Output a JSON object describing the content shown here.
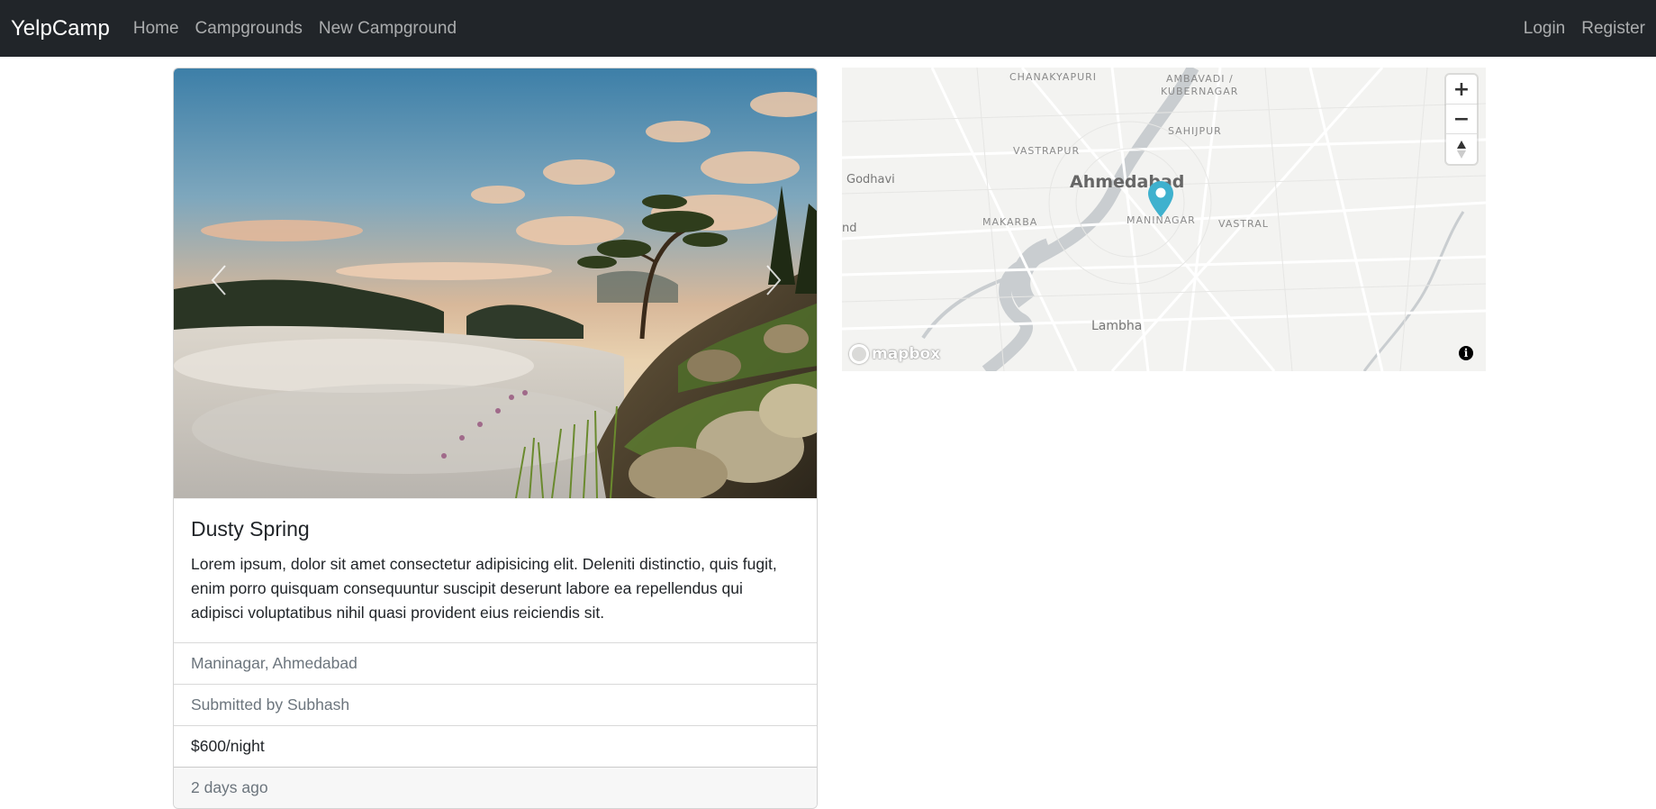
{
  "nav": {
    "brand": "YelpCamp",
    "links": [
      "Home",
      "Campgrounds",
      "New Campground"
    ],
    "right_links": [
      "Login",
      "Register"
    ]
  },
  "campground": {
    "title": "Dusty Spring",
    "description": "Lorem ipsum, dolor sit amet consectetur adipisicing elit. Deleniti distinctio, quis fugit, enim porro quisquam consequuntur suscipit deserunt labore ea repellendus qui adipisci voluptatibus nihil quasi provident eius reiciendis sit.",
    "location": "Maninagar, Ahmedabad",
    "submitted_by": "Submitted by Subhash",
    "price": "$600/night",
    "time_ago": "2 days ago"
  },
  "carousel": {
    "prev_icon": "chevron-left-icon",
    "next_icon": "chevron-right-icon"
  },
  "map": {
    "labels": {
      "chanakyapuri": "CHANAKYAPURI",
      "ambavadi": "AMBAVADI /",
      "kubernagar": "KUBERNAGAR",
      "sahijpur": "SAHIJPUR",
      "vastrapur": "VASTRAPUR",
      "ahmedabad": "Ahmedabad",
      "godhavi": "Godhavi",
      "makarba": "MAKARBA",
      "maninagar": "MANINAGAR",
      "vastral": "VASTRAL",
      "nd": "nd",
      "lambha": "Lambha"
    },
    "controls": {
      "zoom_in": "+",
      "zoom_out": "−",
      "compass": "compass-icon"
    },
    "logo_text": "mapbox",
    "info": "i",
    "marker_color": "#3fb1ce"
  }
}
